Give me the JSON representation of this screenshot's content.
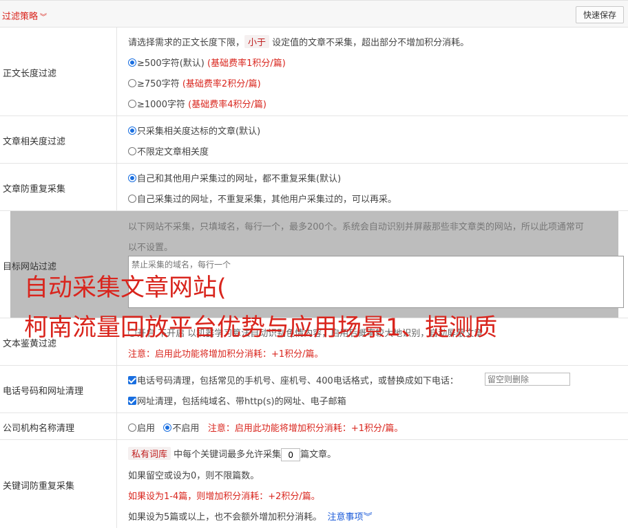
{
  "header": {
    "title": "过滤策略",
    "save_label": "快速保存"
  },
  "length_filter": {
    "label": "正文长度过滤",
    "desc_before": "请选择需求的正文长度下限，",
    "desc_tag": "小于",
    "desc_after": "设定值的文章不采集，超出部分不增加积分消耗。",
    "options": [
      {
        "text": "≥500字符(默认)",
        "note": "(基础费率1积分/篇)",
        "checked": true
      },
      {
        "text": "≥750字符",
        "note": "(基础费率2积分/篇)",
        "checked": false
      },
      {
        "text": "≥1000字符",
        "note": "(基础费率4积分/篇)",
        "checked": false
      }
    ]
  },
  "relevance": {
    "label": "文章相关度过滤",
    "options": [
      "只采集相关度达标的文章(默认)",
      "不限定文章相关度"
    ]
  },
  "dedup": {
    "label": "文章防重复采集",
    "options": [
      "自己和其他用户采集过的网址，都不重复采集(默认)",
      "自己采集过的网址，不重复采集，其他用户采集过的，可以再采。"
    ]
  },
  "target_site": {
    "label": "目标网站过滤",
    "desc_line1": "以下网站不采集，只填域名，每行一个，最多200个。系统会自动识别并屏蔽那些非文章类的网站，所以此项通常可",
    "desc_line2": "以不设置。",
    "placeholder": "禁止采集的域名，每行一个"
  },
  "porn_filter": {
    "label": "文本鉴黄过滤",
    "line": "开启    不开启    以机器学习算法自动识别色情内容，启用后概率较大地识别，自动屏蔽文章",
    "notice": "注意：启用此功能将增加积分消耗：+1积分/篇。"
  },
  "phone_clean": {
    "label": "电话号码和网址清理",
    "phone_text": "电话号码清理，包括常见的手机号、座机号、400电话格式，或替换成如下电话：",
    "phone_placeholder": "留空则删除",
    "url_text": "网址清理，包括纯域名、带http(s)的网址、电子邮箱"
  },
  "org_clean": {
    "label": "公司机构名称清理",
    "on": "启用",
    "off": "不启用",
    "notice": "注意：启用此功能将增加积分消耗：+1积分/篇。"
  },
  "keyword_dedup": {
    "label": "关键词防重复采集",
    "tag": "私有词库",
    "line1_a": "中每个关键词最多允许采集",
    "count_value": "0",
    "line1_b": "篇文章。",
    "line2": "如果留空或设为0，则不限篇数。",
    "line3": "如果设为1-4篇，则增加积分消耗：+2积分/篇。",
    "line4": "如果设为5篇或以上，也不会额外增加积分消耗。",
    "link": "注意事项"
  },
  "watermark": {
    "line1": "自动采集文章网站(",
    "line2": "柯南流量回放平台优势与应用场景1、提测质"
  }
}
